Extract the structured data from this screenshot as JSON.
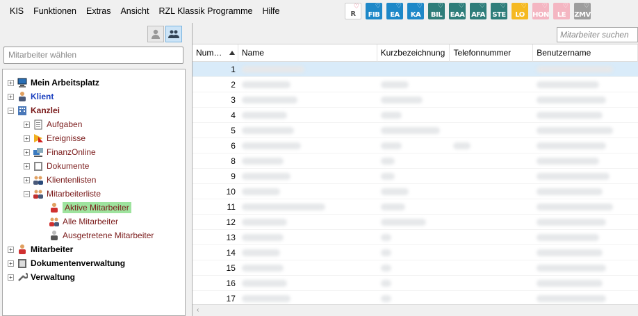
{
  "menu": [
    "KIS",
    "Funktionen",
    "Extras",
    "Ansicht",
    "RZL Klassik Programme",
    "Hilfe"
  ],
  "modules": [
    {
      "label": "R",
      "color": "#ffffff",
      "text_color": "#555555"
    },
    {
      "label": "FIB",
      "color": "#1e88c8"
    },
    {
      "label": "EA",
      "color": "#1e88c8"
    },
    {
      "label": "KA",
      "color": "#1e88c8"
    },
    {
      "label": "BIL",
      "color": "#2e7d7a"
    },
    {
      "label": "EAA",
      "color": "#2e7d7a"
    },
    {
      "label": "AFA",
      "color": "#2e7d7a"
    },
    {
      "label": "STE",
      "color": "#2e7d7a"
    },
    {
      "label": "LO",
      "color": "#f5b921"
    },
    {
      "label": "HON",
      "color": "#f4b6c2"
    },
    {
      "label": "LE",
      "color": "#f4b6c2"
    },
    {
      "label": "ZMV",
      "color": "#9e9e9e"
    }
  ],
  "left": {
    "employee_select_placeholder": "Mitarbeiter wählen"
  },
  "tree": [
    {
      "label": "Mein Arbeitsplatz",
      "level": 0,
      "expander": "+",
      "icon": "computer-icon",
      "style": "bold"
    },
    {
      "label": "Klient",
      "level": 0,
      "expander": "+",
      "icon": "client-icon",
      "style": "bold blue"
    },
    {
      "label": "Kanzlei",
      "level": 0,
      "expander": "-",
      "icon": "building-icon",
      "style": "bold maroon"
    },
    {
      "label": "Aufgaben",
      "level": 1,
      "expander": "+",
      "icon": "clipboard-icon",
      "style": "maroon"
    },
    {
      "label": "Ereignisse",
      "level": 1,
      "expander": "+",
      "icon": "event-icon",
      "style": "maroon"
    },
    {
      "label": "FinanzOnline",
      "level": 1,
      "expander": "+",
      "icon": "finanzonline-icon",
      "style": "maroon"
    },
    {
      "label": "Dokumente",
      "level": 1,
      "expander": "+",
      "icon": "documents-icon",
      "style": "maroon"
    },
    {
      "label": "Klientenlisten",
      "level": 1,
      "expander": "+",
      "icon": "client-list-icon",
      "style": "maroon"
    },
    {
      "label": "Mitarbeiterliste",
      "level": 1,
      "expander": "-",
      "icon": "employee-list-icon",
      "style": "maroon"
    },
    {
      "label": "Aktive Mitarbeiter",
      "level": 2,
      "expander": "",
      "icon": "active-employee-icon",
      "style": "maroon selected"
    },
    {
      "label": "Alle Mitarbeiter",
      "level": 2,
      "expander": "",
      "icon": "all-employees-icon",
      "style": "maroon"
    },
    {
      "label": "Ausgetretene Mitarbeiter",
      "level": 2,
      "expander": "",
      "icon": "former-employee-icon",
      "style": "maroon"
    },
    {
      "label": "Mitarbeiter",
      "level": 0,
      "expander": "+",
      "icon": "employee-icon",
      "style": "bold"
    },
    {
      "label": "Dokumentenverwaltung",
      "level": 0,
      "expander": "+",
      "icon": "document-management-icon",
      "style": "bold"
    },
    {
      "label": "Verwaltung",
      "level": 0,
      "expander": "+",
      "icon": "wrench-icon",
      "style": "bold"
    }
  ],
  "right": {
    "search_placeholder": "Mitarbeiter suchen",
    "columns": [
      "Num…",
      "Name",
      "Kurzbezeichnung",
      "Telefonnummer",
      "Benutzername"
    ],
    "rows": [
      "1",
      "2",
      "3",
      "4",
      "5",
      "6",
      "8",
      "9",
      "10",
      "11",
      "12",
      "13",
      "14",
      "15",
      "16",
      "17"
    ]
  }
}
